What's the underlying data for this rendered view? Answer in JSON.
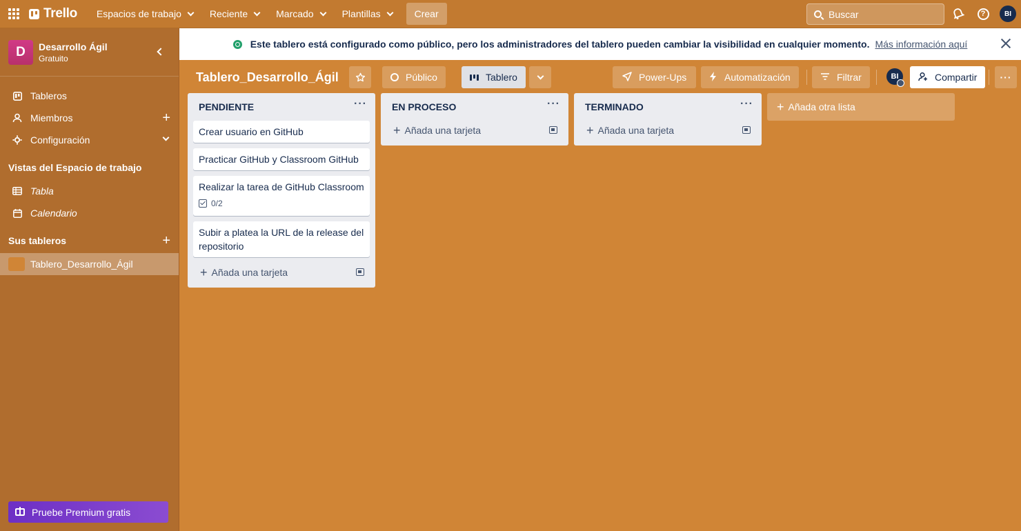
{
  "colors": {
    "board_background": "#d08536",
    "header": "#c27a30",
    "sidebar": "#b06d2e",
    "workspace_badge": "#c93479",
    "premium": "#6d2fc5",
    "list_background": "#ebecf0"
  },
  "header": {
    "logo": "Trello",
    "nav": [
      {
        "label": "Espacios de trabajo",
        "dropdown": true
      },
      {
        "label": "Reciente",
        "dropdown": true
      },
      {
        "label": "Marcado",
        "dropdown": true
      },
      {
        "label": "Plantillas",
        "dropdown": true
      }
    ],
    "create_label": "Crear",
    "search_placeholder": "Buscar",
    "icons": [
      "apps-grid-icon",
      "bell-icon",
      "help-icon"
    ],
    "user_initials": "BI"
  },
  "sidebar": {
    "workspace": {
      "initial": "D",
      "name": "Desarrollo Ágil",
      "plan": "Gratuito"
    },
    "items": [
      {
        "label": "Tableros",
        "icon": "board-icon"
      },
      {
        "label": "Miembros",
        "icon": "member-icon"
      },
      {
        "label": "Configuración",
        "icon": "gear-icon"
      }
    ],
    "views_heading": "Vistas del Espacio de trabajo",
    "views": [
      {
        "label": "Tabla",
        "icon": "table-icon"
      },
      {
        "label": "Calendario",
        "icon": "calendar-icon"
      }
    ],
    "boards_heading": "Sus tableros",
    "boards": [
      {
        "label": "Tablero_Desarrollo_Ágil",
        "active": true
      }
    ],
    "premium_label": "Pruebe Premium gratis"
  },
  "banner": {
    "text": "Este tablero está configurado como público, pero los administradores del tablero pueden cambiar la visibilidad en cualquier momento.",
    "link": "Más información aquí"
  },
  "board": {
    "title": "Tablero_Desarrollo_Ágil",
    "visibility": "Público",
    "view": "Tablero",
    "powerups": "Power-Ups",
    "automation": "Automatización",
    "filter": "Filtrar",
    "member_initials": "BI",
    "share": "Compartir",
    "more": "···"
  },
  "lists": [
    {
      "title": "PENDIENTE",
      "cards": [
        {
          "title": "Crear usuario en GitHub"
        },
        {
          "title": "Practicar GitHub y Classroom GitHub"
        },
        {
          "title": "Realizar la tarea de GitHub Classroom",
          "checklist": "0/2"
        },
        {
          "title": "Subir a platea la URL de la release del repositorio"
        }
      ],
      "add_card": "Añada una tarjeta"
    },
    {
      "title": "EN PROCESO",
      "cards": [],
      "add_card": "Añada una tarjeta"
    },
    {
      "title": "TERMINADO",
      "cards": [],
      "add_card": "Añada una tarjeta"
    }
  ],
  "add_list": "Añada otra lista"
}
